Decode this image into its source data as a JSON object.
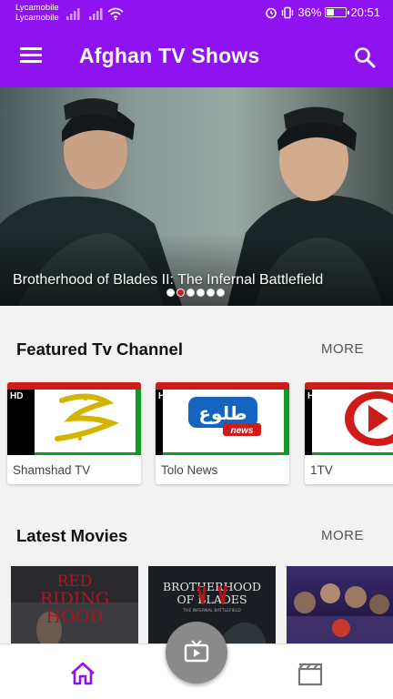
{
  "status_bar": {
    "carrier1": "Lycamobile",
    "carrier2": "Lycamobile",
    "battery": "36%",
    "battery_level": 0.36,
    "time": "20:51"
  },
  "app_bar": {
    "title": "Afghan TV Shows"
  },
  "banner": {
    "title": "Brotherhood of Blades II: The Infernal Battlefield",
    "slide_count": 6,
    "active_slide": 2
  },
  "featured": {
    "title": "Featured Tv Channel",
    "more_label": "MORE",
    "channels": [
      {
        "name": "Shamshad TV",
        "badge": "HD"
      },
      {
        "name": "Tolo News",
        "badge": "HD",
        "logo_text": "طلوع",
        "logo_sub": "news"
      },
      {
        "name": "1TV",
        "badge": "HD"
      }
    ]
  },
  "latest": {
    "title": "Latest Movies",
    "more_label": "MORE",
    "movies": [
      {
        "poster_line1": "RED",
        "poster_line2": "RIDING",
        "poster_line3": "HOOD"
      },
      {
        "poster_line1": "BROTHERHOOD",
        "poster_line2": "OF BLADES",
        "poster_sub": "THE INFERNAL BATTLEFIELD"
      },
      {
        "poster_line1": ""
      }
    ]
  },
  "bottom_nav": {
    "items": [
      "home-icon",
      "live-tv-icon",
      "movies-icon"
    ]
  },
  "colors": {
    "primary": "#8f12f0",
    "accent_red": "#d01b1b",
    "fab": "#8a8a8a"
  }
}
